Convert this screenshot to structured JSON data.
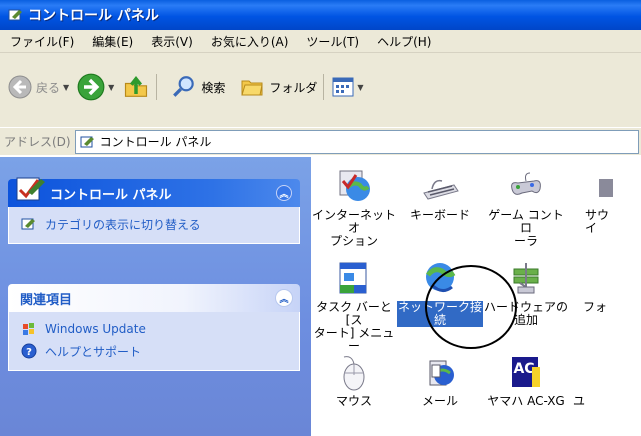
{
  "window": {
    "title": "コントロール パネル"
  },
  "menu": {
    "items": [
      "ファイル(F)",
      "編集(E)",
      "表示(V)",
      "お気に入り(A)",
      "ツール(T)",
      "ヘルプ(H)"
    ]
  },
  "toolbar": {
    "back_label": "戻る",
    "search_label": "検索",
    "folders_label": "フォルダ"
  },
  "address": {
    "label": "アドレス(D)",
    "value": "コントロール パネル"
  },
  "task_panel": {
    "control_panel": {
      "title": "コントロール パネル",
      "links": [
        "カテゴリの表示に切り替える"
      ]
    },
    "related": {
      "title": "関連項目",
      "links": [
        "Windows Update",
        "ヘルプとサポート"
      ]
    }
  },
  "items": [
    {
      "label": "インターネット オ\nプション",
      "icon": "internet-options-icon"
    },
    {
      "label": "キーボード",
      "icon": "keyboard-icon"
    },
    {
      "label": "ゲーム コントロ\nーラ",
      "icon": "game-controller-icon"
    },
    {
      "label": "サウ\nイ",
      "icon": "sound-icon"
    },
    {
      "label": "タスク バーと [ス\nタート] メニュー",
      "icon": "taskbar-icon"
    },
    {
      "label": "ネットワーク接\n続",
      "icon": "network-connections-icon"
    },
    {
      "label": "ハードウェアの\n追加",
      "icon": "add-hardware-icon"
    },
    {
      "label": "フォ",
      "icon": "fonts-icon"
    },
    {
      "label": "マウス",
      "icon": "mouse-icon"
    },
    {
      "label": "メール",
      "icon": "mail-icon"
    },
    {
      "label": "ヤマハ AC-XG",
      "icon": "yamaha-ac-xg-icon"
    },
    {
      "label": "ユ",
      "icon": "user-icon"
    }
  ],
  "colors": {
    "title_bar": "#0054e3",
    "selection": "#316ac5",
    "link": "#215dc6"
  }
}
